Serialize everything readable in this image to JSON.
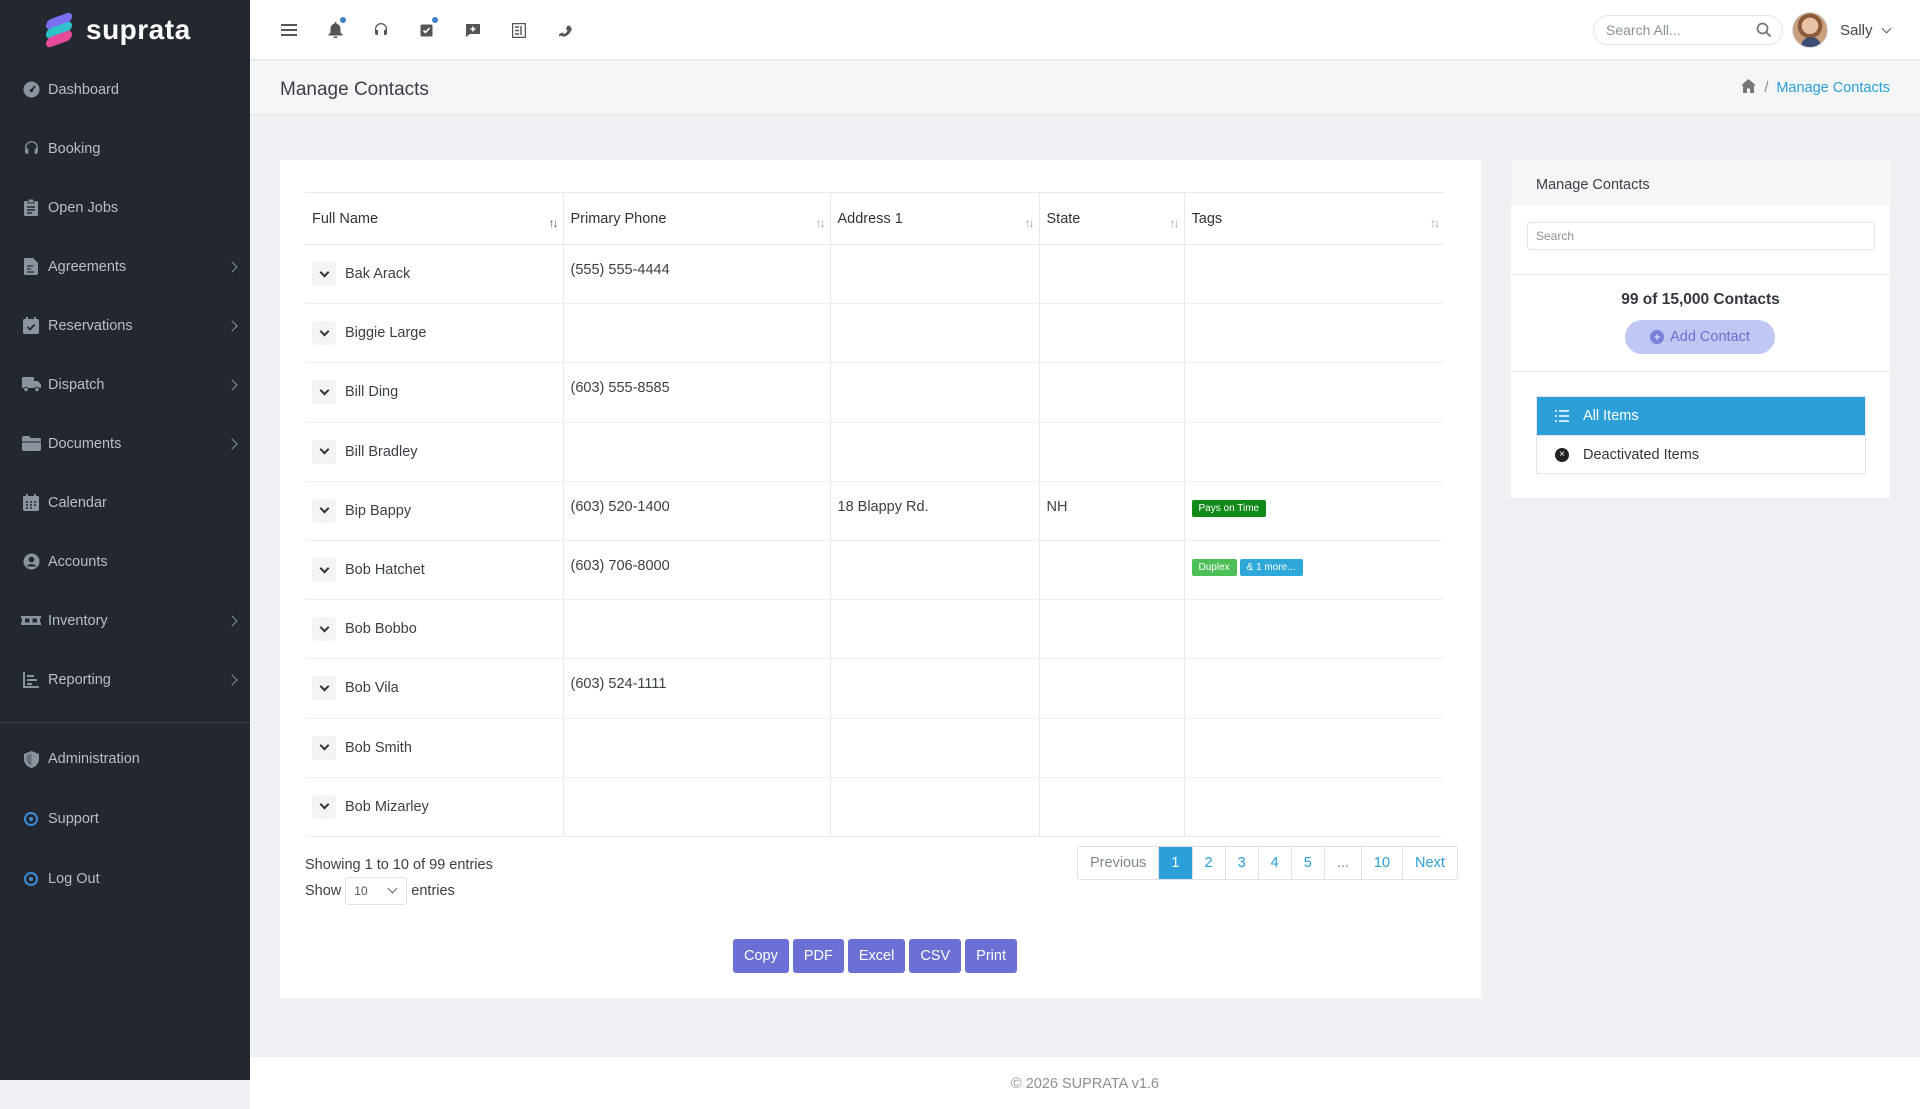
{
  "app": {
    "logo_text": "suprata"
  },
  "sidebar": {
    "items": [
      {
        "label": "Dashboard",
        "icon": "dashboard-icon",
        "has_submenu": false
      },
      {
        "label": "Booking",
        "icon": "headset-icon",
        "has_submenu": false
      },
      {
        "label": "Open Jobs",
        "icon": "clipboard-icon",
        "has_submenu": false
      },
      {
        "label": "Agreements",
        "icon": "file-contract-icon",
        "has_submenu": true
      },
      {
        "label": "Reservations",
        "icon": "calendar-check-icon",
        "has_submenu": true
      },
      {
        "label": "Dispatch",
        "icon": "truck-icon",
        "has_submenu": true
      },
      {
        "label": "Documents",
        "icon": "folder-icon",
        "has_submenu": true
      },
      {
        "label": "Calendar",
        "icon": "calendar-icon",
        "has_submenu": false
      },
      {
        "label": "Accounts",
        "icon": "user-circle-icon",
        "has_submenu": false
      },
      {
        "label": "Inventory",
        "icon": "pallet-icon",
        "has_submenu": true
      },
      {
        "label": "Reporting",
        "icon": "chart-icon",
        "has_submenu": true
      }
    ],
    "bottom_items": [
      {
        "label": "Administration",
        "icon": "shield-icon"
      },
      {
        "label": "Support",
        "icon": "support-ring-icon"
      },
      {
        "label": "Log Out",
        "icon": "logout-ring-icon"
      }
    ]
  },
  "topbar": {
    "icons": [
      "menu-icon",
      "bell-icon",
      "headset-icon",
      "tasks-icon",
      "message-plus-icon",
      "ledger-icon",
      "phone-icon"
    ],
    "search_placeholder": "Search All...",
    "user_name": "Sally"
  },
  "page": {
    "title": "Manage Contacts",
    "breadcrumb_current": "Manage Contacts"
  },
  "table": {
    "columns": [
      "Full Name",
      "Primary Phone",
      "Address 1",
      "State",
      "Tags"
    ],
    "rows": [
      {
        "name": "Bak Arack",
        "phone": "(555) 555-4444",
        "address": "",
        "state": "",
        "tags": []
      },
      {
        "name": "Biggie Large",
        "phone": "",
        "address": "",
        "state": "",
        "tags": []
      },
      {
        "name": "Bill Ding",
        "phone": "(603) 555-8585",
        "address": "",
        "state": "",
        "tags": []
      },
      {
        "name": "Bill Bradley",
        "phone": "",
        "address": "",
        "state": "",
        "tags": []
      },
      {
        "name": "Bip Bappy",
        "phone": "(603) 520-1400",
        "address": "18 Blappy Rd.",
        "state": "NH",
        "tags": [
          {
            "label": "Pays on Time",
            "color": "#118a1a"
          }
        ]
      },
      {
        "name": "Bob Hatchet",
        "phone": "(603) 706-8000",
        "address": "",
        "state": "",
        "tags": [
          {
            "label": "Duplex",
            "color": "#4cbf57"
          },
          {
            "label": "& 1 more...",
            "color": "#2ea7d9"
          }
        ]
      },
      {
        "name": "Bob Bobbo",
        "phone": "",
        "address": "",
        "state": "",
        "tags": []
      },
      {
        "name": "Bob Vila",
        "phone": "(603) 524-1111",
        "address": "",
        "state": "",
        "tags": []
      },
      {
        "name": "Bob Smith",
        "phone": "",
        "address": "",
        "state": "",
        "tags": []
      },
      {
        "name": "Bob Mizarley",
        "phone": "",
        "address": "",
        "state": "",
        "tags": []
      }
    ],
    "info": "Showing 1 to 10 of 99 entries",
    "show_label": "Show",
    "entries_label": "entries",
    "page_size": "10"
  },
  "pagination": {
    "previous": "Previous",
    "pages": [
      "1",
      "2",
      "3",
      "4",
      "5",
      "...",
      "10"
    ],
    "active": "1",
    "next": "Next"
  },
  "exports": [
    "Copy",
    "PDF",
    "Excel",
    "CSV",
    "Print"
  ],
  "panel": {
    "title": "Manage Contacts",
    "search_placeholder": "Search",
    "count": "99 of 15,000 Contacts",
    "add_label": "Add Contact",
    "filters": [
      {
        "label": "All Items",
        "icon": "list-icon",
        "active": true
      },
      {
        "label": "Deactivated Items",
        "icon": "x-circle-icon",
        "active": false
      }
    ]
  },
  "footer": {
    "text": "© 2026 SUPRATA v1.6"
  },
  "colors": {
    "sidebar_bg": "#23272f",
    "accent": "#2c9fd9",
    "button": "#6c6fd3"
  }
}
